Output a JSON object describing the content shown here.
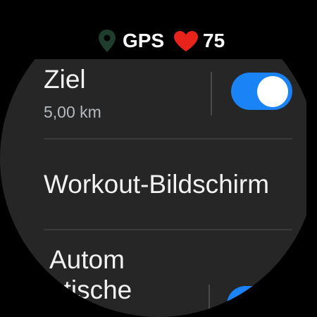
{
  "status_bar": {
    "gps_label": "GPS",
    "heart_rate": "75",
    "gps_icon": "location-pin-icon",
    "heart_icon": "heart-icon",
    "colors": {
      "gps_icon": "#1f3d2c",
      "heart": "#e8231b"
    }
  },
  "settings": {
    "goal": {
      "title": "Ziel",
      "value": "5,00 km",
      "toggle_on": true
    },
    "workout_screen": {
      "title": "Workout-Bildschirm"
    },
    "auto_pause": {
      "title_line1": "Autom",
      "title_line2": "atische",
      "toggle_on": true
    }
  },
  "colors": {
    "background": "#000000",
    "panel": "#262626",
    "accent": "#1a84f7",
    "text_primary": "#f2f2f2",
    "text_secondary": "#b5bac1"
  }
}
